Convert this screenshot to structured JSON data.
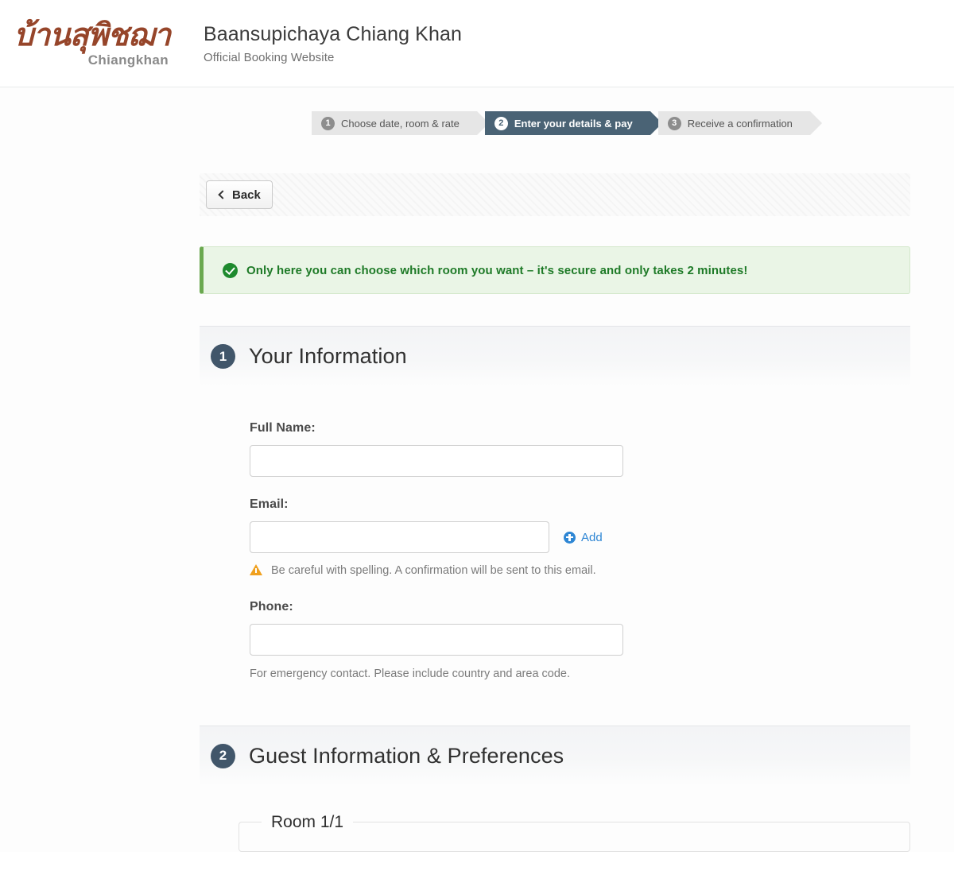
{
  "header": {
    "logo_thai": "บ้านสุพิชฌา",
    "logo_sub": "Chiangkhan",
    "title": "Baansupichaya Chiang Khan",
    "subtitle": "Official Booking Website",
    "logo_color": "#96452a"
  },
  "stepper": {
    "steps": [
      {
        "num": "1",
        "label": "Choose date, room & rate",
        "active": false
      },
      {
        "num": "2",
        "label": "Enter your details & pay",
        "active": true
      },
      {
        "num": "3",
        "label": "Receive a confirmation",
        "active": false
      }
    ],
    "active_color": "#4a6375",
    "inactive_color": "#e6e6e6"
  },
  "toolbar": {
    "back_label": "Back"
  },
  "alert": {
    "message": "Only here you can choose which room you want – it's secure and only takes 2 minutes!",
    "color": "#1e7a27",
    "background": "#eaf5e6"
  },
  "section1": {
    "num": "1",
    "title": "Your Information",
    "fields": {
      "full_name": {
        "label": "Full Name:",
        "value": "",
        "placeholder": ""
      },
      "email": {
        "label": "Email:",
        "value": "",
        "placeholder": "",
        "add_label": "Add",
        "hint": "Be careful with spelling. A confirmation will be sent to this email."
      },
      "phone": {
        "label": "Phone:",
        "value": "",
        "placeholder": "",
        "hint": "For emergency contact. Please include country and area code."
      }
    }
  },
  "section2": {
    "num": "2",
    "title": "Guest Information & Preferences",
    "room_legend": "Room 1/1"
  }
}
